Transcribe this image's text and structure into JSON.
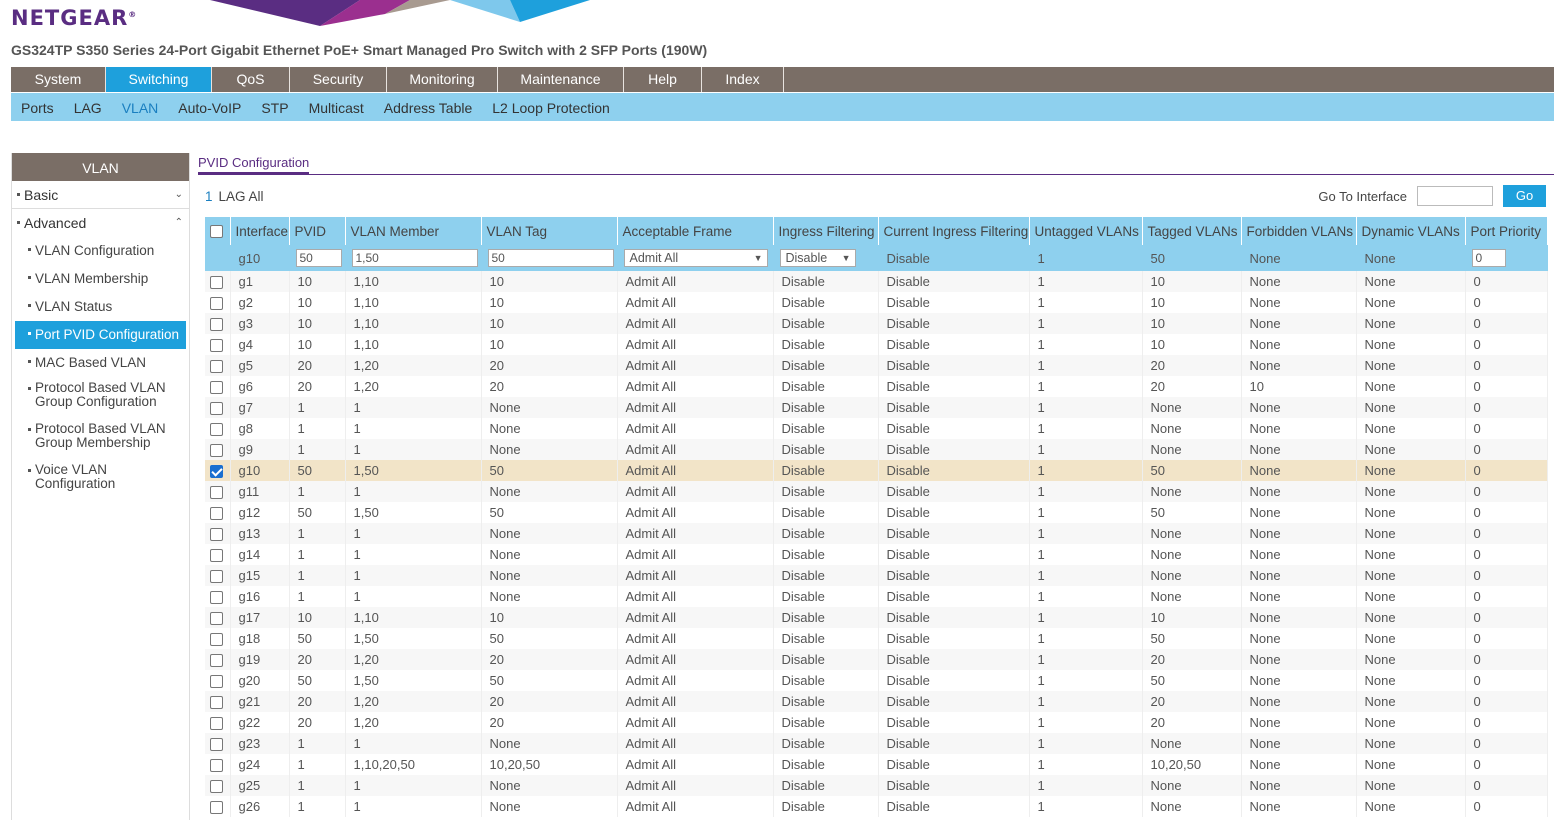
{
  "brand": {
    "logo": "NETGEAR",
    "reg": "®"
  },
  "product_title": "GS324TP S350 Series 24-Port Gigabit Ethernet PoE+ Smart Managed Pro Switch with 2 SFP Ports (190W)",
  "main_nav": [
    "System",
    "Switching",
    "QoS",
    "Security",
    "Monitoring",
    "Maintenance",
    "Help",
    "Index"
  ],
  "sub_nav": [
    "Ports",
    "LAG",
    "VLAN",
    "Auto-VoIP",
    "STP",
    "Multicast",
    "Address Table",
    "L2 Loop Protection"
  ],
  "sidebar": {
    "title": "VLAN",
    "basic": "Basic",
    "advanced": "Advanced",
    "items": [
      "VLAN Configuration",
      "VLAN Membership",
      "VLAN Status",
      "Port PVID Configuration",
      "MAC Based VLAN",
      "Protocol Based VLAN Group Configuration",
      "Protocol Based VLAN Group Membership",
      "Voice VLAN Configuration"
    ],
    "items_split": {
      "p1a": "Protocol Based VLAN",
      "p1b": "Group Configuration",
      "p2a": "Protocol Based VLAN",
      "p2b": "Group Membership",
      "v1a": "Voice VLAN",
      "v1b": "Configuration"
    }
  },
  "content": {
    "tab": "PVID Configuration",
    "lag_one": "1",
    "lag_rest": "LAG All",
    "goto_label": "Go To Interface",
    "goto_value": "",
    "go_button": "Go"
  },
  "table": {
    "headers": [
      "Interface",
      "PVID",
      "VLAN Member",
      "VLAN Tag",
      "Acceptable Frame",
      "Ingress Filtering",
      "Current Ingress Filtering",
      "Untagged VLANs",
      "Tagged VLANs",
      "Forbidden VLANs",
      "Dynamic VLANs",
      "Port Priority"
    ],
    "edit": {
      "interface": "g10",
      "pvid": "50",
      "vlan_member": "1,50",
      "vlan_tag": "50",
      "acceptable_frame": "Admit All",
      "ingress_filtering": "Disable",
      "current_ingress": "Disable",
      "untagged": "1",
      "tagged": "50",
      "forbidden": "None",
      "dynamic": "None",
      "priority": "0"
    },
    "rows": [
      [
        "g1",
        "10",
        "1,10",
        "10",
        "Admit All",
        "Disable",
        "Disable",
        "1",
        "10",
        "None",
        "None",
        "0"
      ],
      [
        "g2",
        "10",
        "1,10",
        "10",
        "Admit All",
        "Disable",
        "Disable",
        "1",
        "10",
        "None",
        "None",
        "0"
      ],
      [
        "g3",
        "10",
        "1,10",
        "10",
        "Admit All",
        "Disable",
        "Disable",
        "1",
        "10",
        "None",
        "None",
        "0"
      ],
      [
        "g4",
        "10",
        "1,10",
        "10",
        "Admit All",
        "Disable",
        "Disable",
        "1",
        "10",
        "None",
        "None",
        "0"
      ],
      [
        "g5",
        "20",
        "1,20",
        "20",
        "Admit All",
        "Disable",
        "Disable",
        "1",
        "20",
        "None",
        "None",
        "0"
      ],
      [
        "g6",
        "20",
        "1,20",
        "20",
        "Admit All",
        "Disable",
        "Disable",
        "1",
        "20",
        "10",
        "None",
        "0"
      ],
      [
        "g7",
        "1",
        "1",
        "None",
        "Admit All",
        "Disable",
        "Disable",
        "1",
        "None",
        "None",
        "None",
        "0"
      ],
      [
        "g8",
        "1",
        "1",
        "None",
        "Admit All",
        "Disable",
        "Disable",
        "1",
        "None",
        "None",
        "None",
        "0"
      ],
      [
        "g9",
        "1",
        "1",
        "None",
        "Admit All",
        "Disable",
        "Disable",
        "1",
        "None",
        "None",
        "None",
        "0"
      ],
      [
        "g10",
        "50",
        "1,50",
        "50",
        "Admit All",
        "Disable",
        "Disable",
        "1",
        "50",
        "None",
        "None",
        "0"
      ],
      [
        "g11",
        "1",
        "1",
        "None",
        "Admit All",
        "Disable",
        "Disable",
        "1",
        "None",
        "None",
        "None",
        "0"
      ],
      [
        "g12",
        "50",
        "1,50",
        "50",
        "Admit All",
        "Disable",
        "Disable",
        "1",
        "50",
        "None",
        "None",
        "0"
      ],
      [
        "g13",
        "1",
        "1",
        "None",
        "Admit All",
        "Disable",
        "Disable",
        "1",
        "None",
        "None",
        "None",
        "0"
      ],
      [
        "g14",
        "1",
        "1",
        "None",
        "Admit All",
        "Disable",
        "Disable",
        "1",
        "None",
        "None",
        "None",
        "0"
      ],
      [
        "g15",
        "1",
        "1",
        "None",
        "Admit All",
        "Disable",
        "Disable",
        "1",
        "None",
        "None",
        "None",
        "0"
      ],
      [
        "g16",
        "1",
        "1",
        "None",
        "Admit All",
        "Disable",
        "Disable",
        "1",
        "None",
        "None",
        "None",
        "0"
      ],
      [
        "g17",
        "10",
        "1,10",
        "10",
        "Admit All",
        "Disable",
        "Disable",
        "1",
        "10",
        "None",
        "None",
        "0"
      ],
      [
        "g18",
        "50",
        "1,50",
        "50",
        "Admit All",
        "Disable",
        "Disable",
        "1",
        "50",
        "None",
        "None",
        "0"
      ],
      [
        "g19",
        "20",
        "1,20",
        "20",
        "Admit All",
        "Disable",
        "Disable",
        "1",
        "20",
        "None",
        "None",
        "0"
      ],
      [
        "g20",
        "50",
        "1,50",
        "50",
        "Admit All",
        "Disable",
        "Disable",
        "1",
        "50",
        "None",
        "None",
        "0"
      ],
      [
        "g21",
        "20",
        "1,20",
        "20",
        "Admit All",
        "Disable",
        "Disable",
        "1",
        "20",
        "None",
        "None",
        "0"
      ],
      [
        "g22",
        "20",
        "1,20",
        "20",
        "Admit All",
        "Disable",
        "Disable",
        "1",
        "20",
        "None",
        "None",
        "0"
      ],
      [
        "g23",
        "1",
        "1",
        "None",
        "Admit All",
        "Disable",
        "Disable",
        "1",
        "None",
        "None",
        "None",
        "0"
      ],
      [
        "g24",
        "1",
        "1,10,20,50",
        "10,20,50",
        "Admit All",
        "Disable",
        "Disable",
        "1",
        "10,20,50",
        "None",
        "None",
        "0"
      ],
      [
        "g25",
        "1",
        "1",
        "None",
        "Admit All",
        "Disable",
        "Disable",
        "1",
        "None",
        "None",
        "None",
        "0"
      ],
      [
        "g26",
        "1",
        "1",
        "None",
        "Admit All",
        "Disable",
        "Disable",
        "1",
        "None",
        "None",
        "None",
        "0"
      ]
    ],
    "selected_interface": "g10"
  },
  "colors": {
    "brand_purple": "#5a2d82",
    "accent_blue": "#1ea0dc",
    "nav_gray": "#7a6e66",
    "header_light_blue": "#8ed0ee",
    "selected_row": "#f2e4c8"
  },
  "icons": {
    "expand": "chevron-down-icon",
    "collapse": "chevron-up-icon",
    "dropdown": "dropdown-arrow-icon"
  }
}
